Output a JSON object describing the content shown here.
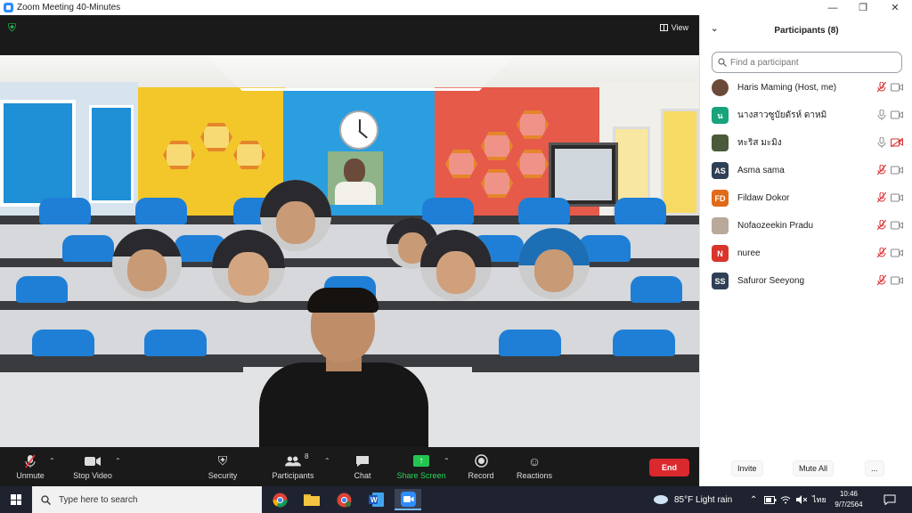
{
  "window": {
    "title": "Zoom Meeting 40-Minutes"
  },
  "meeting": {
    "view_label": "View"
  },
  "toolbar": {
    "unmute": "Unmute",
    "stop_video": "Stop Video",
    "security": "Security",
    "participants": "Participants",
    "participants_count": "8",
    "chat": "Chat",
    "share_screen": "Share Screen",
    "record": "Record",
    "reactions": "Reactions",
    "end": "End"
  },
  "panel": {
    "title": "Participants (8)",
    "search_placeholder": "Find a participant",
    "participants": [
      {
        "name": "Haris Maming (Host, me)",
        "initials": "",
        "color": "#6b4a3a",
        "mic": "muted",
        "video": "on"
      },
      {
        "name": "นางสาวซูบัยดัรห์ ดาหมิ",
        "initials": "น",
        "color": "#18a37b",
        "mic": "on",
        "video": "on"
      },
      {
        "name": "หะริส มะมิง",
        "initials": "",
        "color": "#4a5a3a",
        "mic": "on",
        "video": "off"
      },
      {
        "name": "Asma sama",
        "initials": "AS",
        "color": "#2f3f55",
        "mic": "muted",
        "video": "on"
      },
      {
        "name": "Fildaw Dokor",
        "initials": "FD",
        "color": "#e06a1a",
        "mic": "muted",
        "video": "on"
      },
      {
        "name": "Nofaozeekin Pradu",
        "initials": "",
        "color": "#b9a99a",
        "mic": "muted",
        "video": "on"
      },
      {
        "name": "nuree",
        "initials": "N",
        "color": "#d9352b",
        "mic": "muted",
        "video": "on"
      },
      {
        "name": "Safuror Seeyong",
        "initials": "SS",
        "color": "#2f3f55",
        "mic": "muted",
        "video": "on"
      }
    ],
    "invite": "Invite",
    "mute_all": "Mute All",
    "more": "..."
  },
  "taskbar": {
    "search_placeholder": "Type here to search",
    "weather": "85°F  Light rain",
    "lang": "ไทย",
    "time": "10:46",
    "date": "9/7/2564"
  }
}
